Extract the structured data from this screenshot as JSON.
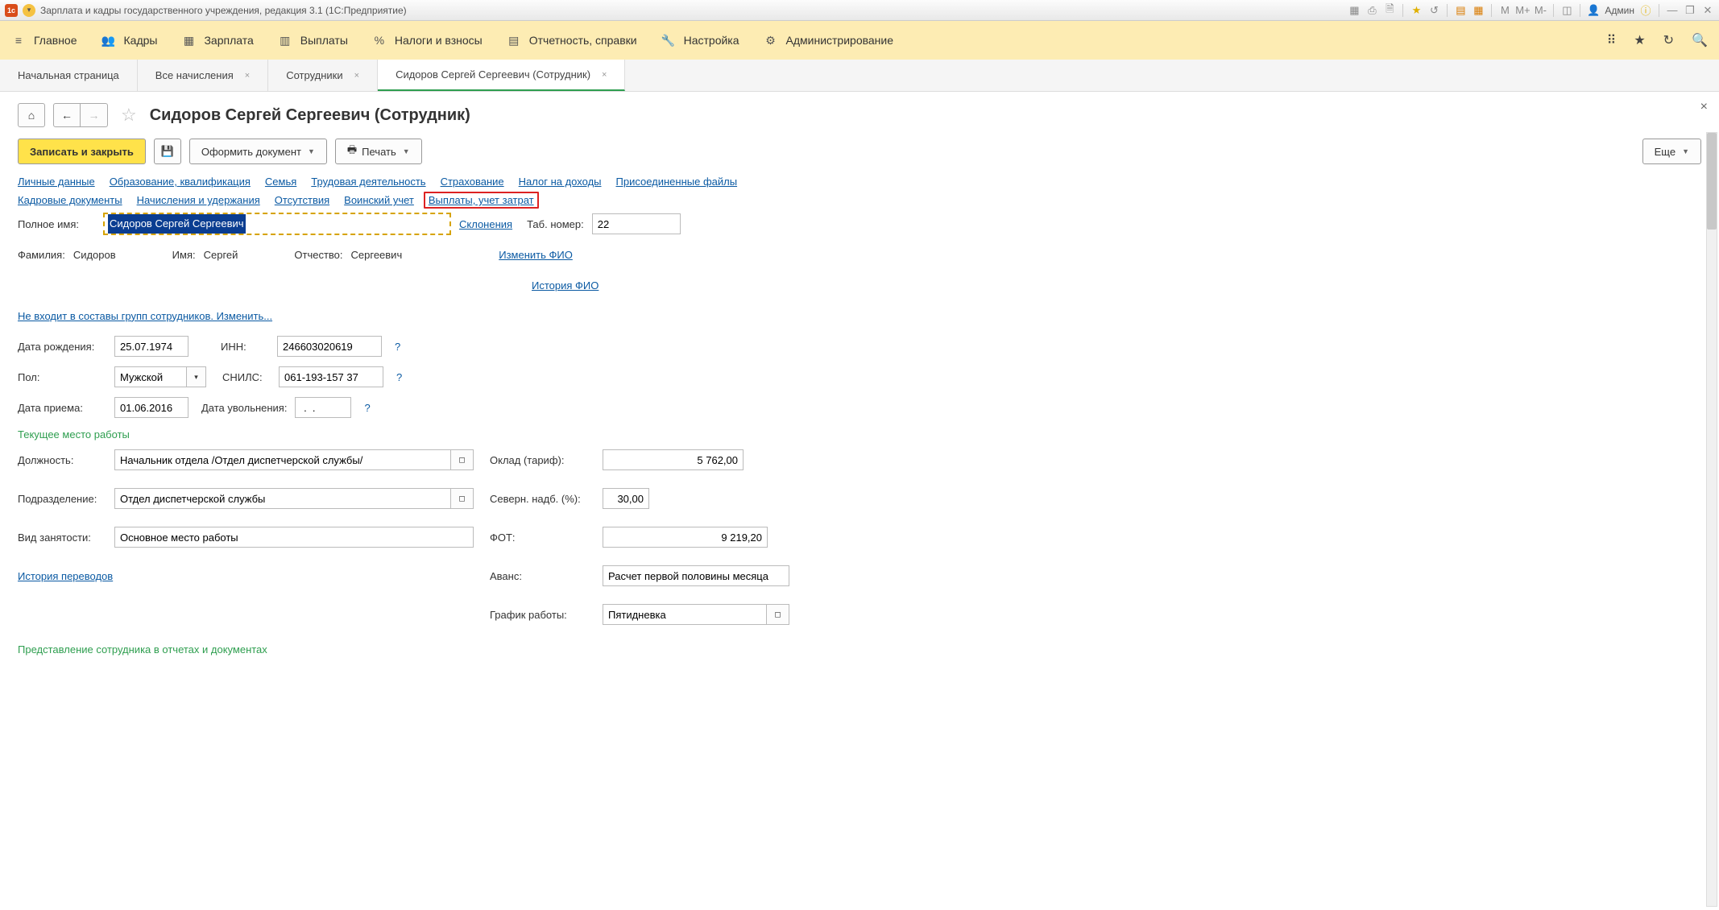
{
  "titlebar": {
    "title": "Зарплата и кадры государственного учреждения, редакция 3.1  (1С:Предприятие)",
    "user": "Админ"
  },
  "mainmenu": {
    "items": [
      {
        "label": "Главное"
      },
      {
        "label": "Кадры"
      },
      {
        "label": "Зарплата"
      },
      {
        "label": "Выплаты"
      },
      {
        "label": "Налоги и взносы"
      },
      {
        "label": "Отчетность, справки"
      },
      {
        "label": "Настройка"
      },
      {
        "label": "Администрирование"
      }
    ]
  },
  "tabs": [
    {
      "label": "Начальная страница",
      "closable": false
    },
    {
      "label": "Все начисления",
      "closable": true
    },
    {
      "label": "Сотрудники",
      "closable": true
    },
    {
      "label": "Сидоров Сергей Сергеевич (Сотрудник)",
      "closable": true,
      "active": true
    }
  ],
  "page": {
    "title": "Сидоров Сергей Сергеевич (Сотрудник)"
  },
  "toolbar": {
    "save_close": "Записать и закрыть",
    "doc": "Оформить документ",
    "print": "Печать",
    "more": "Еще"
  },
  "nav_links": {
    "row1": [
      "Личные данные",
      "Образование, квалификация",
      "Семья",
      "Трудовая деятельность",
      "Страхование",
      "Налог на доходы",
      "Присоединенные файлы"
    ],
    "row2": [
      "Кадровые документы",
      "Начисления и удержания",
      "Отсутствия",
      "Воинский учет",
      "Выплаты, учет затрат"
    ]
  },
  "form": {
    "fullname_label": "Полное имя:",
    "fullname_value": "Сидоров Сергей Сергеевич",
    "declensions": "Склонения",
    "tabnum_label": "Таб. номер:",
    "tabnum_value": "22",
    "lastname_label": "Фамилия:",
    "lastname_value": "Сидоров",
    "firstname_label": "Имя:",
    "firstname_value": "Сергей",
    "patronymic_label": "Отчество:",
    "patronymic_value": "Сергеевич",
    "change_fio": "Изменить ФИО",
    "history_fio": "История ФИО",
    "groups_link": "Не входит в составы групп сотрудников. Изменить...",
    "birthdate_label": "Дата рождения:",
    "birthdate_value": "25.07.1974",
    "inn_label": "ИНН:",
    "inn_value": "246603020619",
    "sex_label": "Пол:",
    "sex_value": "Мужской",
    "snils_label": "СНИЛС:",
    "snils_value": "061-193-157 37",
    "hiredate_label": "Дата приема:",
    "hiredate_value": "01.06.2016",
    "firedate_label": "Дата увольнения:",
    "firedate_value": " .  .  ",
    "workplace_section": "Текущее место работы",
    "position_label": "Должность:",
    "position_value": "Начальник отдела /Отдел диспетчерской службы/",
    "dept_label": "Подразделение:",
    "dept_value": "Отдел диспетчерской службы",
    "emptype_label": "Вид занятости:",
    "emptype_value": "Основное место работы",
    "transfers_link": "История переводов",
    "salary_label": "Оклад (тариф):",
    "salary_value": "5 762,00",
    "north_label": "Северн. надб. (%):",
    "north_value": "30,00",
    "fot_label": "ФОТ:",
    "fot_value": "9 219,20",
    "advance_label": "Аванс:",
    "advance_value": "Расчет первой половины месяца",
    "schedule_label": "График работы:",
    "schedule_value": "Пятидневка",
    "repr_section": "Представление сотрудника в отчетах и документах"
  }
}
